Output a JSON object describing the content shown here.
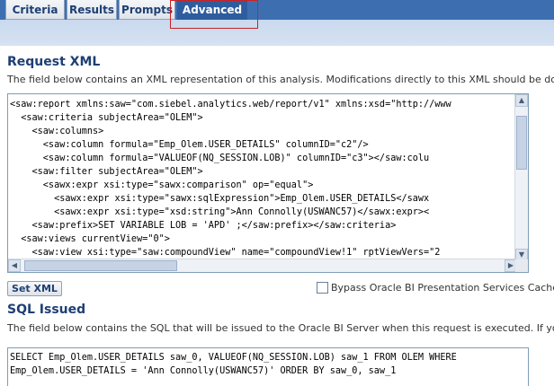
{
  "tabs": [
    {
      "label": "Criteria"
    },
    {
      "label": "Results"
    },
    {
      "label": "Prompts"
    },
    {
      "label": "Advanced"
    }
  ],
  "request_xml": {
    "title": "Request XML",
    "description": "The field below contains an XML representation of this analysis. Modifications directly to this XML should be don",
    "lines": [
      "<saw:report xmlns:saw=\"com.siebel.analytics.web/report/v1\" xmlns:xsd=\"http://www",
      "  <saw:criteria subjectArea=\"OLEM\">",
      "    <saw:columns>",
      "      <saw:column formula=\"Emp_Olem.USER_DETAILS\" columnID=\"c2\"/>",
      "      <saw:column formula=\"VALUEOF(NQ_SESSION.LOB)\" columnID=\"c3\"></saw:colu",
      "    <saw:filter subjectArea=\"OLEM\">",
      "      <sawx:expr xsi:type=\"sawx:comparison\" op=\"equal\">",
      "        <sawx:expr xsi:type=\"sawx:sqlExpression\">Emp_Olem.USER_DETAILS</sawx",
      "        <sawx:expr xsi:type=\"xsd:string\">Ann Connolly(USWANC57)</sawx:expr><",
      "    <saw:prefix>SET VARIABLE LOB = 'APD' ;</saw:prefix></saw:criteria>",
      "  <saw:views currentView=\"0\">",
      "    <saw:view xsi:type=\"saw:compoundView\" name=\"compoundView!1\" rptViewVers=\"2"
    ],
    "set_xml_label": "Set XML",
    "bypass_cache_label": "Bypass Oracle BI Presentation Services Cache"
  },
  "sql_issued": {
    "title": "SQL Issued",
    "description": "The field below contains the SQL that will be issued to the Oracle BI Server when this request is executed. If you",
    "lines": [
      "SELECT Emp_Olem.USER_DETAILS saw_0, VALUEOF(NQ_SESSION.LOB) saw_1 FROM OLEM WHERE",
      "Emp_Olem.USER_DETAILS = 'Ann Connolly(USWANC57)' ORDER BY saw_0, saw_1"
    ]
  }
}
